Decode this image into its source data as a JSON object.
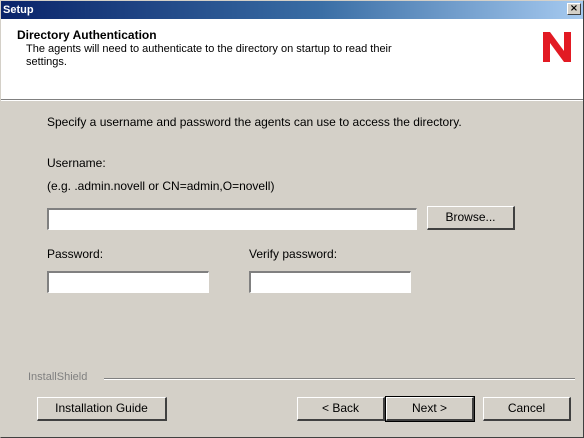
{
  "window": {
    "title": "Setup",
    "close_glyph": "×"
  },
  "header": {
    "title": "Directory Authentication",
    "description": "The agents will need to authenticate to the directory on startup to read their settings.",
    "logo": {
      "icon": "novell-n-logo",
      "color": "#e21a23"
    }
  },
  "body": {
    "instruction": "Specify a username and password the agents can use to access the directory.",
    "username_label": "Username:",
    "username_example": "(e.g. .admin.novell or CN=admin,O=novell)",
    "username_value": "",
    "browse_button": "Browse...",
    "password_label": "Password:",
    "password_value": "",
    "verify_label": "Verify password:",
    "verify_value": ""
  },
  "footer": {
    "brand": "InstallShield",
    "installation_guide_button": "Installation Guide",
    "back_button": "< Back",
    "next_button": "Next >",
    "cancel_button": "Cancel"
  },
  "colors": {
    "titlebar_start": "#0a246a",
    "titlebar_end": "#a6caf0",
    "dialog_face": "#d4d0c8",
    "header_bg": "#ffffff"
  }
}
